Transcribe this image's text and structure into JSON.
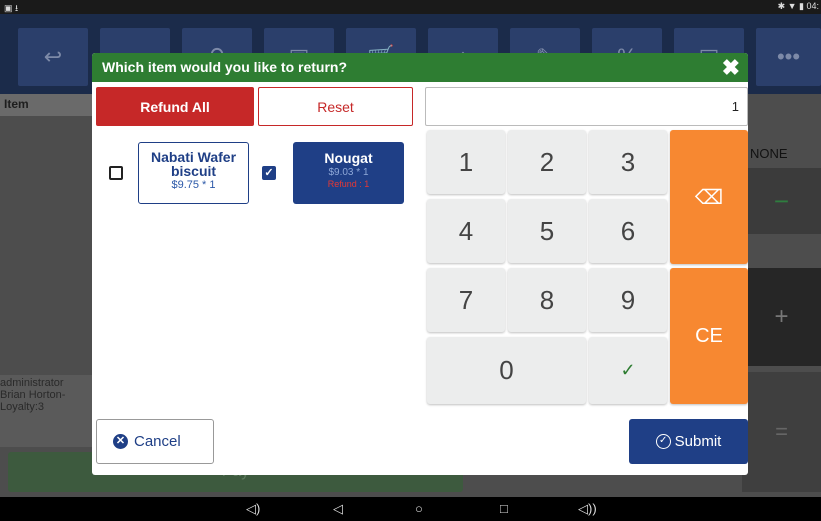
{
  "status_bar": {
    "left_icons": "▣ ⭳",
    "right_text": "✱ ▼ ▮ 04:"
  },
  "background": {
    "item_header": "Item",
    "user_lines": [
      "administrator",
      "Brian Horton-",
      "Loyalty:3"
    ],
    "none_label": "NONE",
    "minus_label": "−",
    "plus_label": "+",
    "equals_label": "=",
    "pay_label": "Pay",
    "toolbar_icons": [
      "↩",
      "⌕",
      "⚲",
      "▣",
      "🛒",
      "⌂",
      "✎",
      "%",
      "▤",
      "•••"
    ]
  },
  "dialog": {
    "title": "Which item would you like to return?",
    "close_label": "✖",
    "refund_all_label": "Refund All",
    "reset_label": "Reset",
    "display_value": "1",
    "items": [
      {
        "name": "Nabati Wafer biscuit",
        "price_line": "$9.75 * 1",
        "checked": false
      },
      {
        "name": "Nougat",
        "price_line": "$9.03 * 1",
        "refund_line": "Refund : 1",
        "checked": true
      }
    ],
    "keypad": {
      "k1": "1",
      "k2": "2",
      "k3": "3",
      "k4": "4",
      "k5": "5",
      "k6": "6",
      "k7": "7",
      "k8": "8",
      "k9": "9",
      "k0": "0",
      "backspace": "⌫",
      "ce": "CE",
      "confirm": "✓"
    },
    "cancel_label": "Cancel",
    "submit_label": "Submit"
  },
  "nav_bar": {
    "icons": [
      "◁)",
      "◁",
      "○",
      "□",
      "◁))"
    ]
  },
  "colors": {
    "header_green": "#2e7d32",
    "refund_red": "#c62828",
    "keypad_orange": "#f78831",
    "primary_navy": "#1f3f86"
  }
}
